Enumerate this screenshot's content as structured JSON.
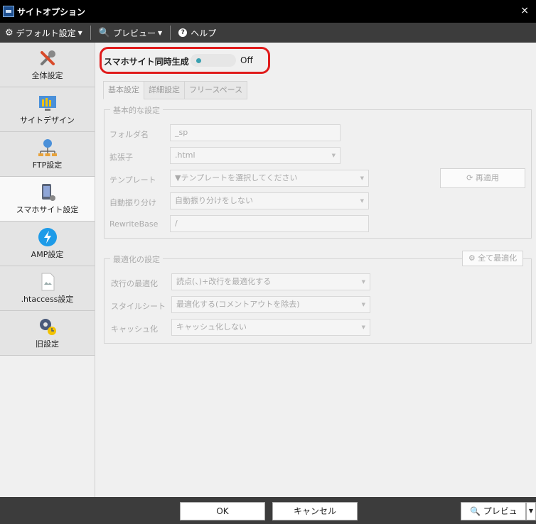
{
  "window": {
    "title": "サイトオプション",
    "close_glyph": "×"
  },
  "toolbar": {
    "default_settings": "デフォルト設定",
    "preview": "プレビュー",
    "help": "ヘルプ"
  },
  "sidebar": {
    "items": [
      {
        "label": "全体設定",
        "icon": "tools-icon"
      },
      {
        "label": "サイトデザイン",
        "icon": "design-icon"
      },
      {
        "label": "FTP設定",
        "icon": "network-icon"
      },
      {
        "label": "スマホサイト設定",
        "icon": "smartphone-icon",
        "active": true
      },
      {
        "label": "AMP設定",
        "icon": "amp-bolt-icon"
      },
      {
        "label": ".htaccess設定",
        "icon": "htaccess-file-icon"
      },
      {
        "label": "旧設定",
        "icon": "legacy-settings-icon"
      }
    ]
  },
  "main": {
    "sync_label": "スマホサイト同時生成",
    "toggle_state": "Off",
    "tabs": [
      {
        "label": "基本設定",
        "active": true
      },
      {
        "label": "詳細設定"
      },
      {
        "label": "フリースペース"
      }
    ],
    "basic_group": {
      "title": "基本的な設定",
      "folder_label": "フォルダ名",
      "folder_value": "_sp",
      "extension_label": "拡張子",
      "extension_value": ".html",
      "template_label": "テンプレート",
      "template_value": "▼テンプレートを選択してください",
      "reapply_label": "再適用",
      "auto_label": "自動振り分け",
      "auto_value": "自動振り分けをしない",
      "rewrite_label": "RewriteBase",
      "rewrite_value": "/"
    },
    "optimize_group": {
      "title": "最適化の設定",
      "all_optimize_label": "全て最適化",
      "linebreak_label": "改行の最適化",
      "linebreak_value": "読点(、)+改行を最適化する",
      "stylesheet_label": "スタイルシート",
      "stylesheet_value": "最適化する(コメントアウトを除去)",
      "cache_label": "キャッシュ化",
      "cache_value": "キャッシュ化しない"
    }
  },
  "footer": {
    "ok": "OK",
    "cancel": "キャンセル",
    "preview": "プレビュー"
  },
  "colors": {
    "highlight": "#e01b1b",
    "toggle_knob": "#3aa0b0",
    "toolbar": "#3c3c3c"
  }
}
